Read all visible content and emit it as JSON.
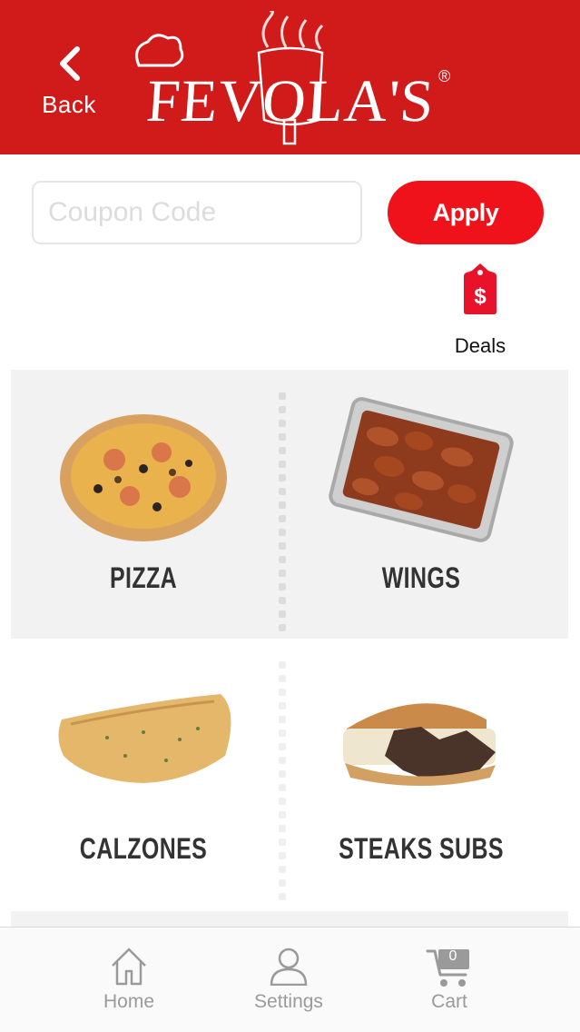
{
  "header": {
    "back_label": "Back",
    "logo_text": "FEVOLA'S",
    "logo_mark": "®",
    "background_color": "#d11b1b"
  },
  "coupon": {
    "placeholder": "Coupon Code",
    "value": "",
    "apply_label": "Apply",
    "apply_color": "#f0121a"
  },
  "deals": {
    "label": "Deals",
    "icon": "price-tag-dollar-icon"
  },
  "categories": [
    {
      "label": "PIZZA",
      "icon": "pizza-image"
    },
    {
      "label": "WINGS",
      "icon": "wings-tray-image"
    },
    {
      "label": "CALZONES",
      "icon": "calzone-image"
    },
    {
      "label": "STEAKS SUBS",
      "icon": "steak-sub-image"
    }
  ],
  "tabbar": {
    "items": [
      {
        "label": "Home",
        "icon": "home-icon"
      },
      {
        "label": "Settings",
        "icon": "user-icon"
      },
      {
        "label": "Cart",
        "icon": "cart-icon",
        "badge": "0"
      }
    ]
  }
}
